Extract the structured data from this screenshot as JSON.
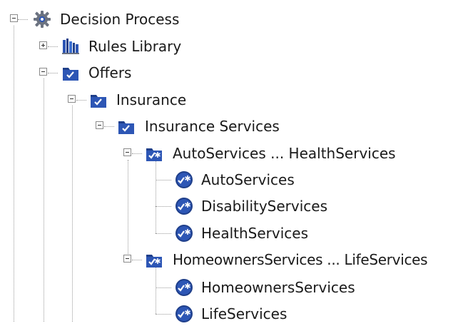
{
  "colors": {
    "folder": "#1f3f8a",
    "folder_tab": "#2d56b5",
    "check": "#ffffff",
    "gear": "#6b7280",
    "text": "#1a1a1a"
  },
  "tree": {
    "root": {
      "label": "Decision Process",
      "icon": "gear-icon",
      "expanded": true
    },
    "rules_library": {
      "label": "Rules Library",
      "icon": "library-books-icon",
      "expanded": false
    },
    "offers": {
      "label": "Offers",
      "icon": "checked-folder-icon",
      "expanded": true
    },
    "insurance": {
      "label": "Insurance",
      "icon": "checked-folder-icon",
      "expanded": true
    },
    "insurance_services": {
      "label": "Insurance Services",
      "icon": "checked-folder-icon",
      "expanded": true
    },
    "group_auto": {
      "label": "AutoServices ... HealthServices",
      "icon": "checked-group-icon",
      "expanded": true
    },
    "auto": {
      "label": "AutoServices",
      "icon": "checked-offer-icon"
    },
    "disability": {
      "label": "DisabilityServices",
      "icon": "checked-offer-icon"
    },
    "health": {
      "label": "HealthServices",
      "icon": "checked-offer-icon"
    },
    "group_home": {
      "label": "HomeownersServices ... LifeServices",
      "icon": "checked-group-icon",
      "expanded": true
    },
    "homeowners": {
      "label": "HomeownersServices",
      "icon": "checked-offer-icon"
    },
    "life": {
      "label": "LifeServices",
      "icon": "checked-offer-icon"
    }
  }
}
